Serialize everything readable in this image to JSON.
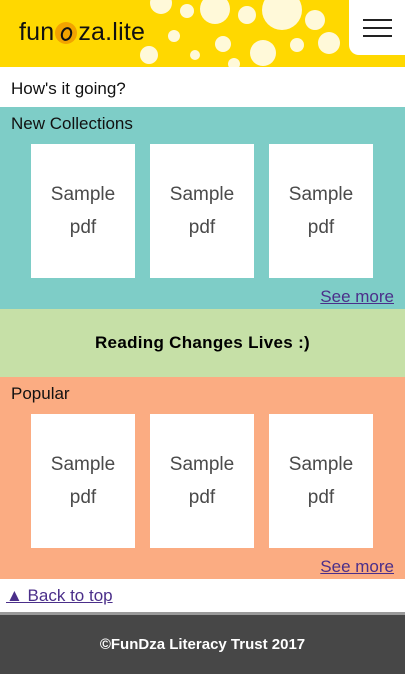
{
  "header": {
    "logo_left": "fun",
    "logo_right": "za.lite",
    "menu_icon": "hamburger-menu-icon"
  },
  "greeting": "How's it going?",
  "new_collections": {
    "title": "New Collections",
    "cards": [
      {
        "line1": "Sample",
        "line2": "pdf"
      },
      {
        "line1": "Sample",
        "line2": "pdf"
      },
      {
        "line1": "Sample",
        "line2": "pdf"
      }
    ],
    "see_more": "See more"
  },
  "banner": {
    "text": "Reading Changes Lives :)"
  },
  "popular": {
    "title": "Popular",
    "cards": [
      {
        "line1": "Sample",
        "line2": "pdf"
      },
      {
        "line1": "Sample",
        "line2": "pdf"
      },
      {
        "line1": "Sample",
        "line2": "pdf"
      }
    ],
    "see_more": "See more"
  },
  "back_to_top": "▲ Back to top",
  "footer": {
    "text": "©FunDza Literacy Trust 2017"
  },
  "colors": {
    "header_bg": "#ffd800",
    "new_collections_bg": "#7ecdc7",
    "banner_bg": "#c6e0a7",
    "popular_bg": "#fbac82",
    "footer_bg": "#474747",
    "link": "#4b2f8a"
  }
}
